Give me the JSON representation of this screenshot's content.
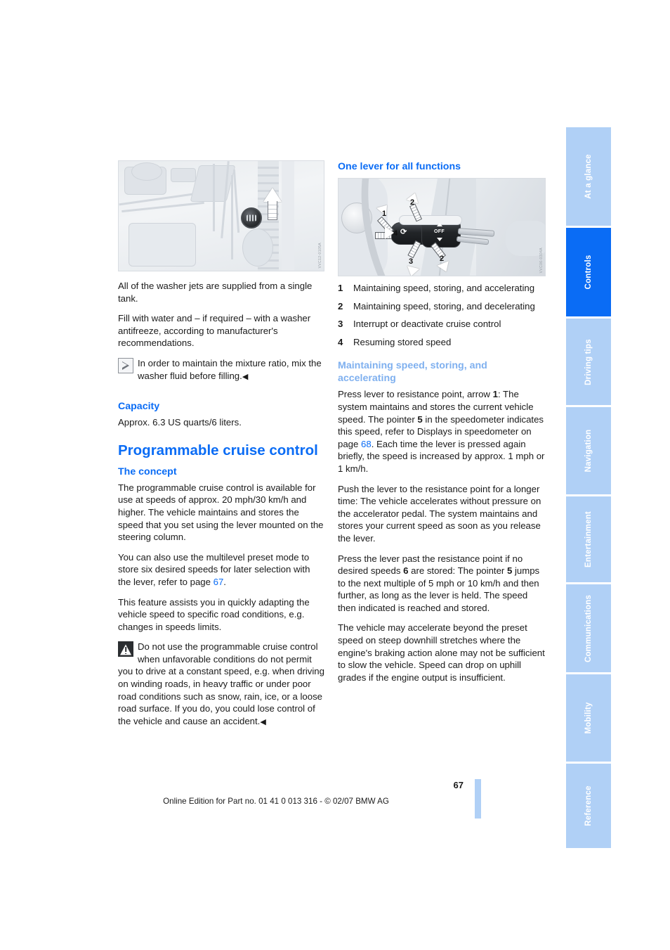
{
  "document": {
    "page_number": "67",
    "footer": "Online Edition for Part no. 01 41 0 013 316 - © 02/07 BMW AG"
  },
  "side_tabs": [
    {
      "label": "At a glance",
      "active": false
    },
    {
      "label": "Controls",
      "active": true
    },
    {
      "label": "Driving tips",
      "active": false
    },
    {
      "label": "Navigation",
      "active": false
    },
    {
      "label": "Entertainment",
      "active": false
    },
    {
      "label": "Communications",
      "active": false
    },
    {
      "label": "Mobility",
      "active": false
    },
    {
      "label": "Reference",
      "active": false
    }
  ],
  "left_column": {
    "figure_code": "VVC12-0105A",
    "para_1": "All of the washer jets are supplied from a single tank.",
    "para_2": "Fill with water and – if required – with a washer antifreeze, according to manufacturer's recommendations.",
    "note_1": "In order to maintain the mixture ratio, mix the washer fluid before filling.",
    "note_1_end": "◀",
    "capacity_heading": "Capacity",
    "capacity_text": "Approx. 6.3 US quarts/6 liters.",
    "main_heading": "Programmable cruise control",
    "concept_heading": "The concept",
    "concept_para_1": "The programmable cruise control is available for use at speeds of approx. 20 mph/30 km/h and higher. The vehicle maintains and stores the speed that you set using the lever mounted on the steering column.",
    "concept_para_2_a": "You can also use the multilevel preset mode to store six desired speeds for later selection with the lever, refer to page ",
    "concept_para_2_ref": "67",
    "concept_para_2_b": ".",
    "concept_para_3": "This feature assists you in quickly adapting the vehicle speed to specific road conditions, e.g. changes in speeds limits.",
    "warning_text": "Do not use the programmable cruise control when unfavorable conditions do not permit you to drive at a constant speed, e.g. when driving on winding roads, in heavy traffic or under poor road conditions such as snow, rain, ice, or a loose road surface. If you do, you could lose control of the vehicle and cause an accident.",
    "warning_end": "◀"
  },
  "right_column": {
    "lever_heading": "One lever for all functions",
    "figure_code": "VVC06-0304A",
    "lever_image_labels": {
      "off": "OFF",
      "callouts": [
        "1",
        "2",
        "3",
        "4"
      ]
    },
    "legend": [
      {
        "num": "1",
        "text": "Maintaining speed, storing, and accelerating"
      },
      {
        "num": "2",
        "text": "Maintaining speed, storing, and decelerating"
      },
      {
        "num": "3",
        "text": "Interrupt or deactivate cruise control"
      },
      {
        "num": "4",
        "text": "Resuming stored speed"
      }
    ],
    "maintaining_heading": "Maintaining speed, storing, and accelerating",
    "para_1_a": "Press lever to resistance point, arrow ",
    "para_1_b1": "1",
    "para_1_c": ": The system maintains and stores the current vehicle speed. The pointer ",
    "para_1_b2": "5",
    "para_1_d": " in the speedometer indicates this speed, refer to Displays in speedometer on page ",
    "para_1_ref": "68",
    "para_1_e": ". Each time the lever is pressed again briefly, the speed is increased by approx. 1 mph or 1 km/h.",
    "para_2": "Push the lever to the resistance point for a longer time: The vehicle accelerates without pressure on the accelerator pedal. The system maintains and stores your current speed as soon as you release the lever.",
    "para_3_a": "Press the lever past the resistance point if no desired speeds ",
    "para_3_b1": "6",
    "para_3_c": " are stored: The pointer ",
    "para_3_b2": "5",
    "para_3_d": " jumps to the next multiple of 5 mph or 10 km/h and then further, as long as the lever is held. The speed then indicated is reached and stored.",
    "para_4": "The vehicle may accelerate beyond the preset speed on steep downhill stretches where the engine's braking action alone may not be sufficient to slow the vehicle. Speed can drop on uphill grades if the engine output is insufficient."
  },
  "colors": {
    "accent_blue": "#0a6cf5",
    "pale_blue": "#b0d0f6",
    "heading_pale": "#7fb0ef",
    "text": "#1a1a1a"
  }
}
